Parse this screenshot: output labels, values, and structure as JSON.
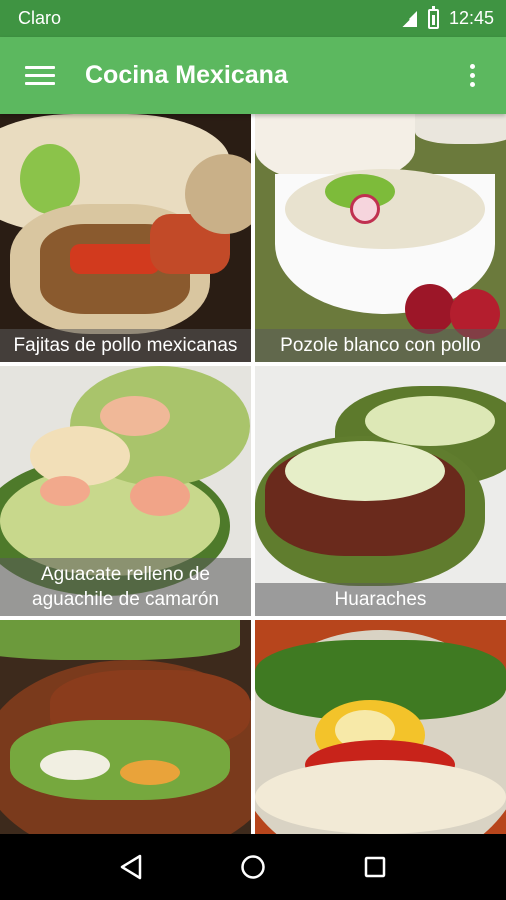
{
  "status_bar": {
    "carrier": "Claro",
    "time": "12:45",
    "icons": [
      "signal-icon",
      "battery-icon"
    ]
  },
  "app_bar": {
    "title": "Cocina Mexicana",
    "menu_icon": "hamburger-menu-icon",
    "overflow_icon": "more-vert-icon"
  },
  "recipes": [
    {
      "name": "Fajitas de pollo mexicanas"
    },
    {
      "name": "Pozole blanco con pollo"
    },
    {
      "name": "Aguacate relleno de aguachile de camarón"
    },
    {
      "name": "Huaraches"
    },
    {
      "name": ""
    },
    {
      "name": ""
    }
  ],
  "nav_bar": {
    "back": "back-icon",
    "home": "home-icon",
    "recents": "recents-icon"
  },
  "colors": {
    "status_bar": "#3f9442",
    "app_bar": "#5cb85f"
  }
}
